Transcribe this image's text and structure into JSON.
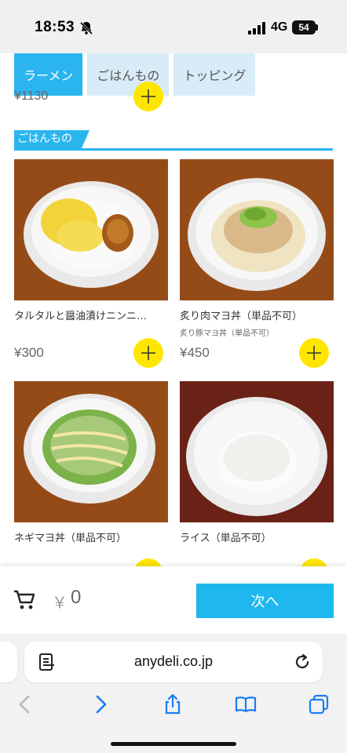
{
  "status_bar": {
    "time": "18:53",
    "network": "4G",
    "battery": "54"
  },
  "tabs": [
    {
      "label": "ラーメン",
      "active": true
    },
    {
      "label": "ごはんもの",
      "active": false
    },
    {
      "label": "トッピング",
      "active": false
    }
  ],
  "previous_item": {
    "price": "¥1130"
  },
  "section": {
    "title": "ごはんもの"
  },
  "products": [
    {
      "name": "タルタルと醤油漬けニンニ…",
      "subtitle": "",
      "price": "¥300"
    },
    {
      "name": "炙り肉マヨ丼（単品不可）",
      "subtitle": "炙り豚マヨ丼（単品不可）",
      "price": "¥450"
    },
    {
      "name": "ネギマヨ丼（単品不可）",
      "subtitle": "",
      "price": ""
    },
    {
      "name": "ライス（単品不可）",
      "subtitle": "",
      "price": ""
    }
  ],
  "cart": {
    "currency": "￥",
    "total": "0",
    "next_label": "次へ"
  },
  "browser": {
    "url": "anydeli.co.jp"
  },
  "colors": {
    "accent": "#2ab5ef",
    "add_button": "#ffe600",
    "tab_inactive": "#d7ecf7"
  },
  "icons": [
    "bell-off-icon",
    "signal-icon",
    "battery-icon",
    "plus-icon",
    "cart-icon",
    "reader-icon",
    "reload-icon",
    "back-icon",
    "forward-icon",
    "share-icon",
    "bookmarks-icon",
    "tabs-icon"
  ]
}
